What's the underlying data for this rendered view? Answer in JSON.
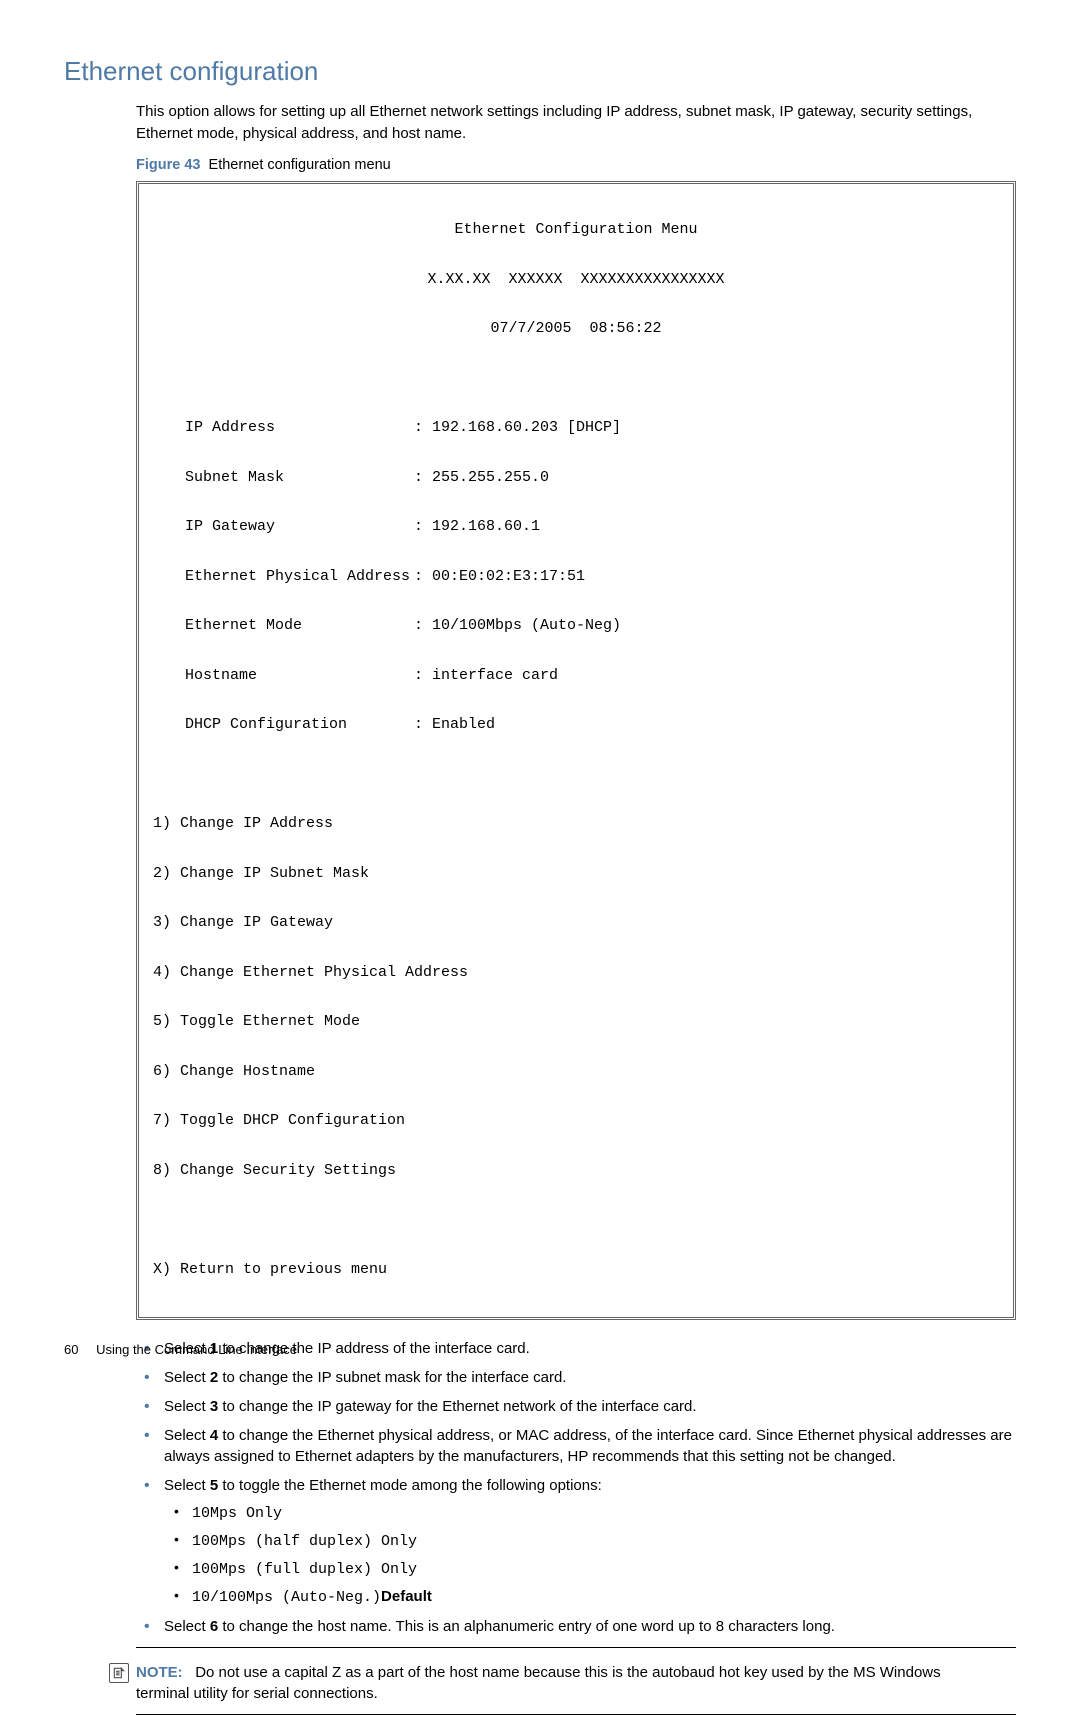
{
  "section": {
    "title": "Ethernet configuration",
    "intro": "This option allows for setting up all Ethernet network settings including IP address, subnet mask, IP gateway, security settings, Ethernet mode, physical address, and host name."
  },
  "figure": {
    "label": "Figure 43",
    "caption": "Ethernet configuration menu"
  },
  "terminal": {
    "title": "Ethernet Configuration Menu",
    "version_line": "X.XX.XX  XXXXXX  XXXXXXXXXXXXXXXX",
    "datetime": "07/7/2005  08:56:22",
    "rows": [
      {
        "label": "IP Address",
        "value": ": 192.168.60.203 [DHCP]"
      },
      {
        "label": "Subnet Mask",
        "value": ": 255.255.255.0"
      },
      {
        "label": "IP Gateway",
        "value": ": 192.168.60.1"
      },
      {
        "label": "Ethernet Physical Address",
        "value": ": 00:E0:02:E3:17:51"
      },
      {
        "label": "Ethernet Mode",
        "value": ": 10/100Mbps (Auto-Neg)"
      },
      {
        "label": "Hostname",
        "value": ": interface card"
      },
      {
        "label": "DHCP Configuration",
        "value": ": Enabled"
      }
    ],
    "options": [
      "1) Change IP Address",
      "2) Change IP Subnet Mask",
      "3) Change IP Gateway",
      "4) Change Ethernet Physical Address",
      "5) Toggle Ethernet Mode",
      "6) Change Hostname",
      "7) Toggle DHCP Configuration",
      "8) Change Security Settings"
    ],
    "exit": "X) Return to previous menu"
  },
  "bullets": {
    "b1_pre": "Select ",
    "b1_num": "1",
    "b1_post": " to change the IP address of the interface card.",
    "b2_pre": "Select ",
    "b2_num": "2",
    "b2_post": " to change the IP subnet mask for the interface card.",
    "b3_pre": "Select ",
    "b3_num": "3",
    "b3_post": " to change the IP gateway for the Ethernet network of the interface card.",
    "b4_pre": "Select ",
    "b4_num": "4",
    "b4_post": " to change the Ethernet physical address, or MAC address, of the interface card. Since Ethernet physical addresses are always assigned to Ethernet adapters by the manufacturers, HP recommends that this setting not be changed.",
    "b5_pre": "Select ",
    "b5_num": "5",
    "b5_post": " to toggle the Ethernet mode among the following options:",
    "sub1": "10Mps Only",
    "sub2": "100Mps (half duplex) Only",
    "sub3": "100Mps (full duplex) Only",
    "sub4a": "10/100Mps (Auto-Neg.)",
    "sub4b": "Default",
    "b6_pre": "Select ",
    "b6_num": "6",
    "b6_post": " to change the host name. This is an alphanumeric entry of one word up to 8 characters long."
  },
  "note": {
    "label": "NOTE:",
    "text": "Do not use a capital Z as a part of the host name because this is the autobaud hot key used by the MS Windows terminal utility for serial connections."
  },
  "footer": {
    "page": "60",
    "chapter": "Using the Command Line Interface"
  }
}
